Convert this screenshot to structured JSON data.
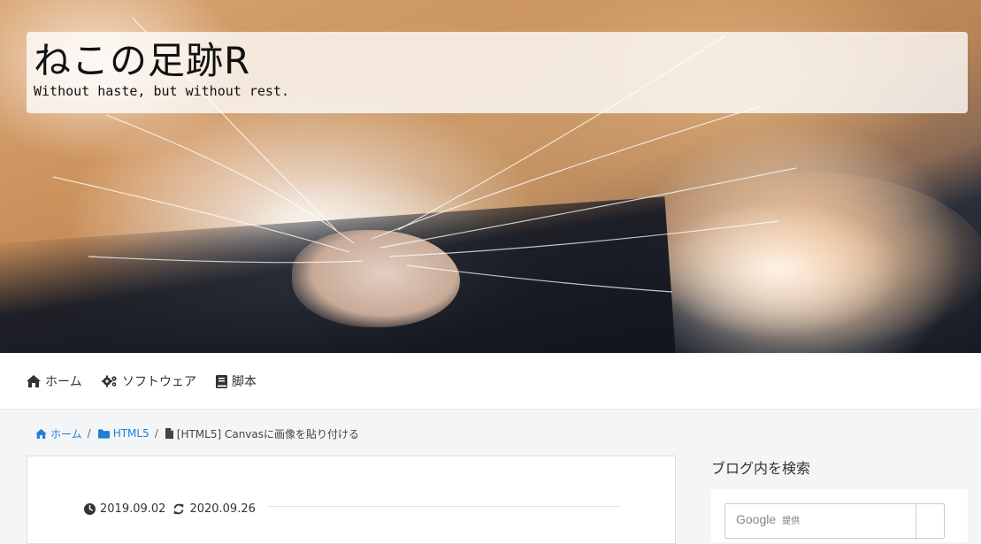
{
  "header": {
    "site_title": "ねこの足跡R",
    "tagline": "Without haste, but without rest."
  },
  "nav": {
    "items": [
      {
        "label": "ホーム",
        "icon": "home-icon"
      },
      {
        "label": "ソフトウェア",
        "icon": "gears-icon"
      },
      {
        "label": "脚本",
        "icon": "book-icon"
      }
    ]
  },
  "breadcrumb": {
    "home": "ホーム",
    "category": "HTML5",
    "current": "[HTML5] Canvasに画像を貼り付ける",
    "separator": "/"
  },
  "post": {
    "published": "2019.09.02",
    "updated": "2020.09.26"
  },
  "sidebar": {
    "search_heading": "ブログ内を検索",
    "search_brand": "Google",
    "search_brand_suffix": "提供"
  },
  "colors": {
    "link": "#1e7fd6",
    "text": "#333333",
    "page_bg": "#f4f5f6"
  }
}
